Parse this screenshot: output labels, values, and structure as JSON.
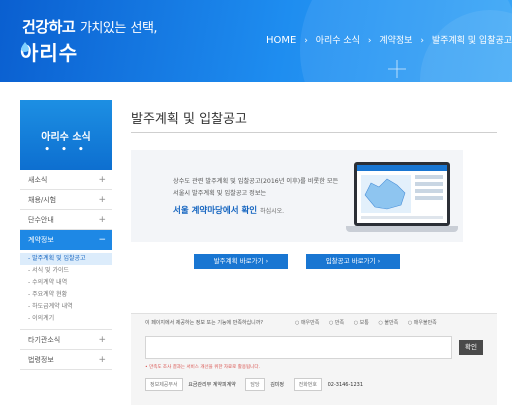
{
  "header": {
    "slogan_a": "건강하고",
    "slogan_b": "가치있는",
    "slogan_c": "선택,",
    "brand": "아리수",
    "breadcrumb": [
      "HOME",
      "아리수 소식",
      "계약정보",
      "발주계획 및 입찰공고"
    ]
  },
  "sidebar": {
    "title": "아리수 소식",
    "dots": "• • •",
    "items": [
      {
        "label": "새소식",
        "icon": "+"
      },
      {
        "label": "채용/시험",
        "icon": "+"
      },
      {
        "label": "단수안내",
        "icon": "+"
      },
      {
        "label": "계약정보",
        "icon": "−"
      }
    ],
    "subitems": [
      "발주계획 및 입찰공고",
      "서식 및 가이드",
      "수의계약 내역",
      "주요계약 현황",
      "하도급계약 내역",
      "이의계기"
    ],
    "more_items": [
      {
        "label": "타기관소식",
        "icon": "+"
      },
      {
        "label": "법령정보",
        "icon": "+"
      }
    ]
  },
  "main": {
    "title": "발주계획 및 입찰공고",
    "intro_line1": "상수도 관련 발주계획 및 입찰공고(2016년 이후)를 비롯한 모든",
    "intro_line2": "서울시 발주계획 및 입찰공고 정보는",
    "intro_big": "서울 계약마당에서 확인",
    "intro_suffix": "하십시오.",
    "btn_plan": "발주계획 바로가기  ›",
    "btn_bid": "입찰공고 바로가기  ›"
  },
  "survey": {
    "question": "이 페이지에서 제공하는 정보 또는 기능에 만족하십니까?",
    "options": [
      "매우만족",
      "만족",
      "보통",
      "불만족",
      "매우불만족"
    ],
    "placeholder": "",
    "submit": "확인",
    "warning": "• 만족도 조사 결과는 서비스 개선을 위한 자료로 활용됩니다.",
    "info": [
      {
        "label": "정보제공부서",
        "value": "요금관리부 계약피계약"
      },
      {
        "label": "담당",
        "value": "김미정"
      },
      {
        "label": "전화번호",
        "value": "02-3146-1231"
      }
    ]
  },
  "colors": {
    "brand_blue": "#1976d2",
    "banner_light": "#3aa6f7",
    "sidebar_active": "#1e88e5"
  }
}
